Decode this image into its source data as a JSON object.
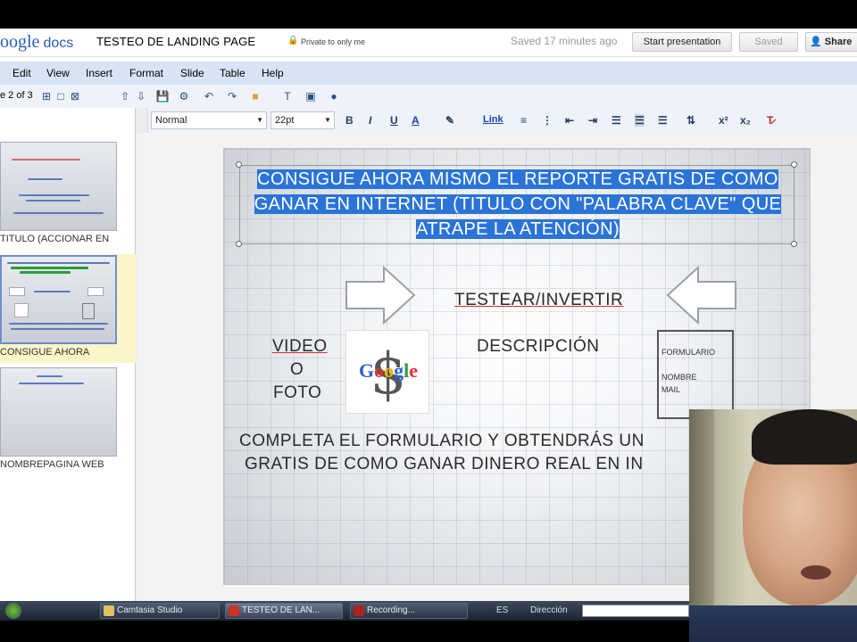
{
  "header": {
    "logo_google": "oogle",
    "logo_docs": "docs",
    "document_title": "TESTEO DE LANDING PAGE",
    "privacy": "Private to only me",
    "saved_status": "Saved 17 minutes ago",
    "start_presentation": "Start presentation",
    "saved_button": "Saved",
    "share_button": "Share"
  },
  "menu": [
    "Edit",
    "View",
    "Insert",
    "Format",
    "Slide",
    "Table",
    "Help"
  ],
  "toolbar": {
    "slide_count": "e 2 of 3",
    "style_select": "Normal",
    "size_select": "22pt",
    "link_label": "Link"
  },
  "sidebar": {
    "slides": [
      {
        "label": "TITULO (ACCIONAR EN",
        "lines": [
          "TITULO (ACCIONAR EN 3\")",
          "FOTO O VIDEO",
          "BENEFICIOS DE LA FOTO \"REPORTE GRATUITO\"",
          "GRATUITO (SIGUE) PRIMEROS SEGUNDO VEDE"
        ]
      },
      {
        "label": "CONSIGUE AHORA",
        "lines": [
          "CONSIGUE AHORA MISMO EL REPORTE GRATIS DE COMO GANAR EN INTERNET",
          "TESTEAR/INVERTIR",
          "DESCRIPCIÓN"
        ]
      },
      {
        "label": "NOMBREPAGINA WEB",
        "lines": [
          "NOMBRE",
          "PAGINA WEB - BLOG"
        ]
      }
    ]
  },
  "slide": {
    "title": "CONSIGUE AHORA MISMO EL REPORTE GRATIS DE COMO GANAR EN INTERNET (TITULO CON \"PALABRA CLAVE\" QUE ATRAPE LA ATENCIÓN)",
    "testear": "TESTEAR/INVERTIR",
    "video": "VIDEO",
    "o": "O",
    "foto": "FOTO",
    "descripcion": "DESCRIPCIÓN",
    "form_title": "FORMULARIO",
    "form_nombre": "NOMBRE",
    "form_mail": "MAIL",
    "completa_line1": "COMPLETA EL FORMULARIO Y OBTENDRÁS UN",
    "completa_line2": "GRATIS DE COMO GANAR DINERO REAL EN IN",
    "google_logo_text": "Google"
  },
  "taskbar": {
    "items": [
      "Camtasia Studio",
      "TESTEO DE LAN...",
      "Recording..."
    ],
    "tray_text": "ES",
    "tray_extra": "Dirección"
  },
  "colors": {
    "menubar": "#d8e4f5",
    "title_highlight": "#2a74d8",
    "spell_underline": "#d93030"
  }
}
